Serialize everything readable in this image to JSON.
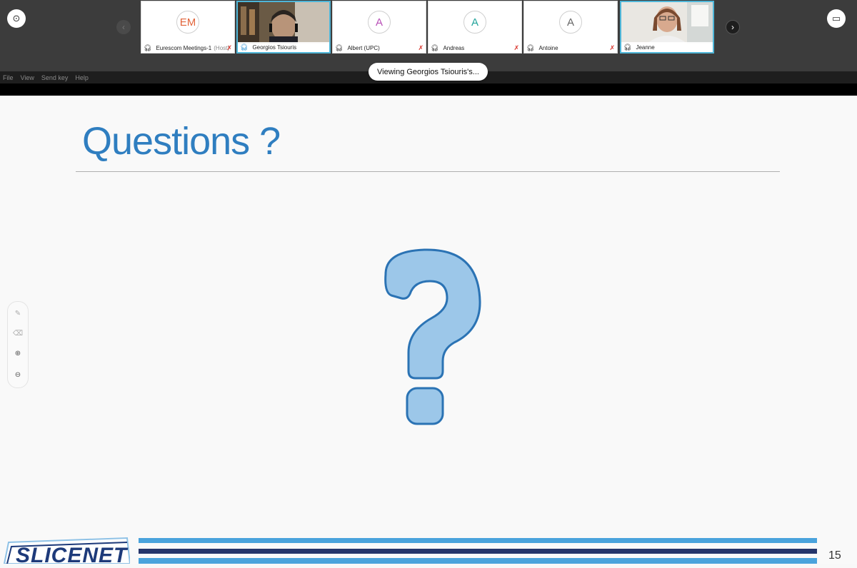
{
  "participants": [
    {
      "name": "Eurescom Meetings-1",
      "role": "(Host)",
      "initials": "EM",
      "initials_color": "#e2643a",
      "muted": true,
      "video": false
    },
    {
      "name": "Georgios Tsiouris",
      "role": "",
      "initials": "",
      "initials_color": "",
      "muted": false,
      "video": true
    },
    {
      "name": "Albert (UPC)",
      "role": "",
      "initials": "A",
      "initials_color": "#b84fb7",
      "muted": true,
      "video": false
    },
    {
      "name": "Andreas",
      "role": "",
      "initials": "A",
      "initials_color": "#20a39a",
      "muted": true,
      "video": false
    },
    {
      "name": "Antoine",
      "role": "",
      "initials": "A",
      "initials_color": "#666666",
      "muted": true,
      "video": false
    },
    {
      "name": "Jeanne",
      "role": "",
      "initials": "",
      "initials_color": "",
      "muted": false,
      "video": true
    }
  ],
  "menu": {
    "file": "File",
    "view": "View",
    "send_key": "Send key",
    "help": "Help"
  },
  "viewing_label": "Viewing Georgios Tsiouris's...",
  "slide": {
    "title": "Questions ?",
    "logo_text": "SLICENET",
    "page_number": "15"
  },
  "colors": {
    "title_blue": "#2f7ec0",
    "qmark_fill": "#9cc7e9",
    "qmark_stroke": "#2b73b4"
  },
  "icons": {
    "left_circle": "target-icon",
    "right_square": "window-icon",
    "prev": "chevron-left-icon",
    "next": "chevron-right-icon",
    "audio": "headset-icon",
    "mute": "mic-muted-icon",
    "tools": [
      "pen-icon",
      "eraser-icon",
      "zoom-in-icon",
      "zoom-out-icon"
    ]
  }
}
